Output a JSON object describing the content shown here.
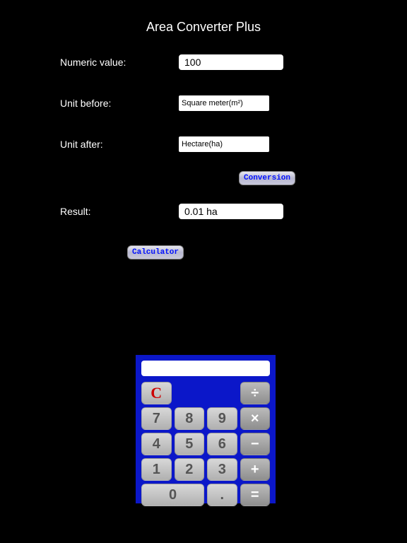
{
  "title": "Area Converter Plus",
  "form": {
    "numeric_label": "Numeric value:",
    "numeric_value": "100",
    "before_label": "Unit before:",
    "before_value": "Square meter(m²)",
    "after_label": "Unit after:",
    "after_value": "Hectare(ha)",
    "conversion_btn": "Conversion",
    "result_label": "Result:",
    "result_value": "0.01 ha",
    "calculator_btn": "Calculator"
  },
  "calc": {
    "display": "",
    "keys": {
      "c": "C",
      "div": "÷",
      "k7": "7",
      "k8": "8",
      "k9": "9",
      "mul": "×",
      "k4": "4",
      "k5": "5",
      "k6": "6",
      "sub": "−",
      "k1": "1",
      "k2": "2",
      "k3": "3",
      "add": "+",
      "k0": "0",
      "dot": ".",
      "eq": "="
    }
  }
}
